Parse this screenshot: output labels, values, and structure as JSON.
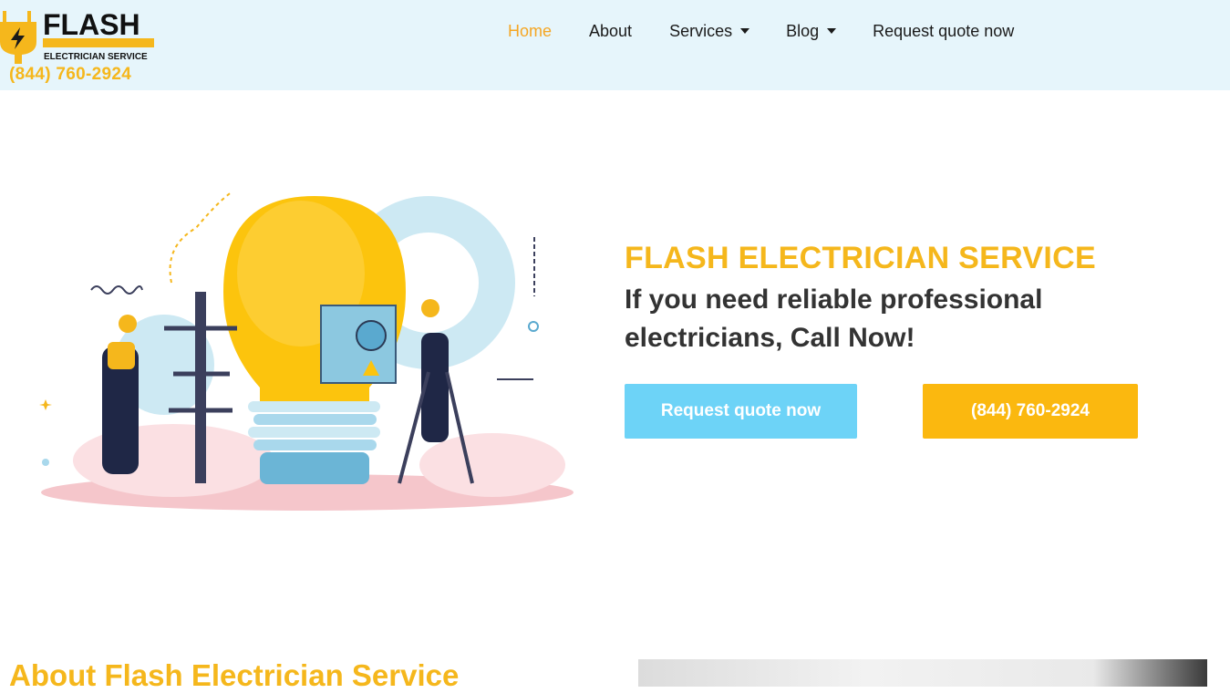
{
  "header": {
    "logo": {
      "name": "FLASH",
      "tagline": "ELECTRICIAN SERVICE"
    },
    "phone": "(844) 760-2924"
  },
  "nav": {
    "items": [
      {
        "label": "Home",
        "active": true,
        "dropdown": false
      },
      {
        "label": "About",
        "active": false,
        "dropdown": false
      },
      {
        "label": "Services",
        "active": false,
        "dropdown": true
      },
      {
        "label": "Blog",
        "active": false,
        "dropdown": true
      },
      {
        "label": "Request quote now",
        "active": false,
        "dropdown": false
      }
    ]
  },
  "hero": {
    "title": "FLASH ELECTRICIAN SERVICE",
    "subtitle": "If you need reliable professional electricians, Call Now!",
    "buttons": {
      "quote": "Request quote now",
      "call": "(844) 760-2924"
    },
    "illustration_icon": "electricians-lightbulb-illustration"
  },
  "about": {
    "title": "About Flash Electrician Service"
  },
  "colors": {
    "accent": "#f5b71c",
    "header_bg": "#e6f5fb",
    "quote_btn": "#6dd3f7",
    "call_btn": "#fbb80f",
    "active_nav": "#f5a623"
  }
}
